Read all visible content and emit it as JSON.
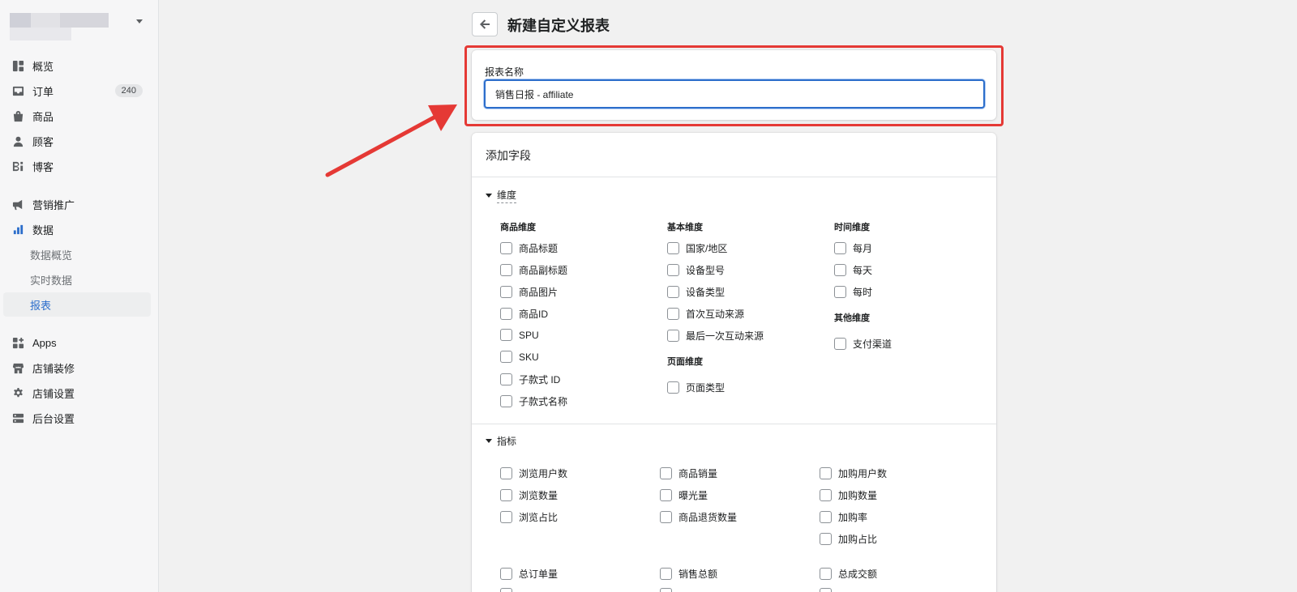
{
  "sidebar": {
    "items": [
      {
        "label": "概览",
        "icon": "dashboard-icon"
      },
      {
        "label": "订单",
        "icon": "inbox-icon",
        "badge": "240"
      },
      {
        "label": "商品",
        "icon": "bag-icon"
      },
      {
        "label": "顾客",
        "icon": "person-icon"
      },
      {
        "label": "博客",
        "icon": "blog-icon"
      },
      {
        "label": "营销推广",
        "icon": "megaphone-icon"
      },
      {
        "label": "数据",
        "icon": "bar-chart-icon"
      },
      {
        "label": "数据概览"
      },
      {
        "label": "实时数据"
      },
      {
        "label": "报表"
      },
      {
        "label": "Apps",
        "icon": "apps-icon"
      },
      {
        "label": "店铺装修",
        "icon": "store-icon"
      },
      {
        "label": "店铺设置",
        "icon": "gear-icon"
      },
      {
        "label": "后台设置",
        "icon": "server-icon"
      }
    ]
  },
  "header": {
    "title": "新建自定义报表"
  },
  "name_card": {
    "label": "报表名称",
    "value": "销售日报 - affiliate"
  },
  "fields": {
    "title": "添加字段",
    "dimensions": {
      "heading": "维度",
      "product": {
        "title": "商品维度",
        "items": [
          "商品标题",
          "商品副标题",
          "商品图片",
          "商品ID",
          "SPU",
          "SKU",
          "子款式 ID",
          "子款式名称"
        ]
      },
      "basic": {
        "title": "基本维度",
        "items": [
          "国家/地区",
          "设备型号",
          "设备类型",
          "首次互动来源",
          "最后一次互动来源"
        ]
      },
      "page": {
        "title": "页面维度",
        "items": [
          "页面类型"
        ]
      },
      "time": {
        "title": "时间维度",
        "items": [
          "每月",
          "每天",
          "每时"
        ]
      },
      "other": {
        "title": "其他维度",
        "items": [
          "支付渠道"
        ]
      }
    },
    "metrics": {
      "heading": "指标",
      "col1": [
        "浏览用户数",
        "浏览数量",
        "浏览占比"
      ],
      "col2": [
        "商品销量",
        "曝光量",
        "商品退货数量"
      ],
      "col3": [
        "加购用户数",
        "加购数量",
        "加购率",
        "加购占比"
      ],
      "row2": [
        "总订单量",
        "销售总额",
        "总成交额"
      ]
    }
  },
  "colors": {
    "accent": "#2c6ecb",
    "highlight": "#e53935"
  }
}
